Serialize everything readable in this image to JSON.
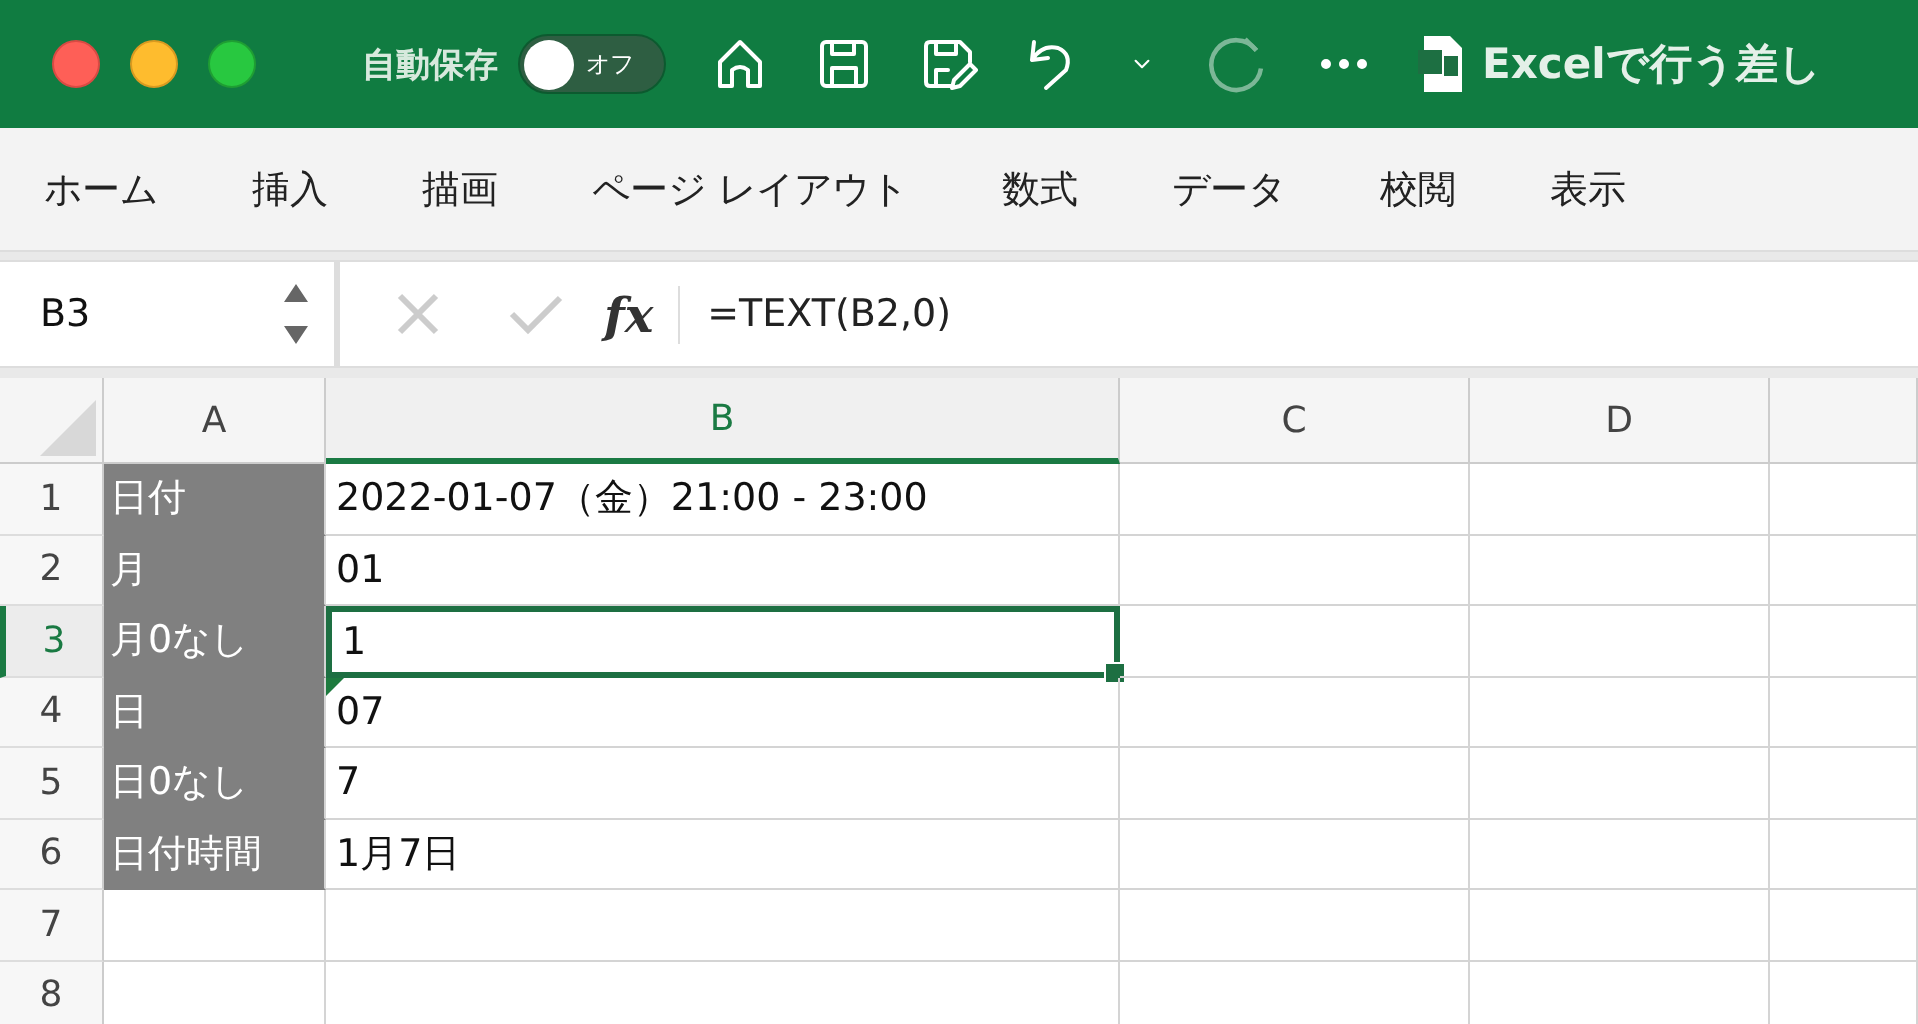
{
  "title_bar": {
    "autosave_label": "自動保存",
    "autosave": {
      "on": false,
      "label": "オフ"
    },
    "redo_disabled": true,
    "document_title": "Excelで行う差し"
  },
  "ribbon_tabs": [
    "ホーム",
    "挿入",
    "描画",
    "ページ レイアウト",
    "数式",
    "データ",
    "校閲",
    "表示"
  ],
  "formula_bar": {
    "name_box": "B3",
    "function_label": "fx",
    "formula": "=TEXT(B2,0)"
  },
  "columns": [
    {
      "label": "A",
      "selected": false
    },
    {
      "label": "B",
      "selected": true
    },
    {
      "label": "C",
      "selected": false
    },
    {
      "label": "D",
      "selected": false
    }
  ],
  "rows": [
    {
      "header": "1",
      "selected": false,
      "cells": [
        {
          "text": "日付",
          "active": false,
          "flagged": false
        },
        {
          "text": "2022-01-07（金）21:00 - 23:00",
          "active": false,
          "flagged": false
        }
      ]
    },
    {
      "header": "2",
      "selected": false,
      "cells": [
        {
          "text": "月",
          "active": false,
          "flagged": false
        },
        {
          "text": "01",
          "active": false,
          "flagged": false
        }
      ]
    },
    {
      "header": "3",
      "selected": true,
      "cells": [
        {
          "text": "月0なし",
          "active": false,
          "flagged": false
        },
        {
          "text": "1",
          "active": true,
          "flagged": false
        }
      ]
    },
    {
      "header": "4",
      "selected": false,
      "cells": [
        {
          "text": "日",
          "active": false,
          "flagged": false
        },
        {
          "text": "07",
          "active": false,
          "flagged": true
        }
      ]
    },
    {
      "header": "5",
      "selected": false,
      "cells": [
        {
          "text": "日0なし",
          "active": false,
          "flagged": false
        },
        {
          "text": "7",
          "active": false,
          "flagged": false
        }
      ]
    },
    {
      "header": "6",
      "selected": false,
      "cells": [
        {
          "text": "日付時間",
          "active": false,
          "flagged": false
        },
        {
          "text": "1月7日",
          "active": false,
          "flagged": false
        }
      ]
    },
    {
      "header": "7",
      "selected": false,
      "cells": []
    },
    {
      "header": "8",
      "selected": false,
      "cells": []
    }
  ]
}
